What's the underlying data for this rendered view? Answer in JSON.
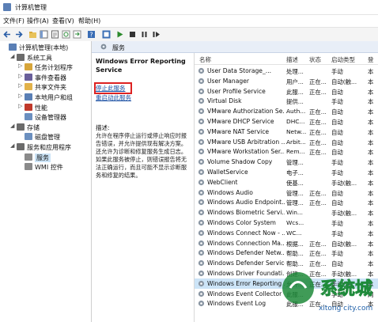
{
  "window": {
    "title": "计算机管理"
  },
  "menu": [
    "文件(F)",
    "操作(A)",
    "查看(V)",
    "帮助(H)"
  ],
  "tree": [
    {
      "label": "计算机管理(本地)",
      "indent": 0,
      "exp": "",
      "color": "#5a7fb5"
    },
    {
      "label": "系统工具",
      "indent": 1,
      "exp": "◢",
      "color": "#6b6b6b"
    },
    {
      "label": "任务计划程序",
      "indent": 2,
      "exp": "▷",
      "color": "#d7a53a"
    },
    {
      "label": "事件查看器",
      "indent": 2,
      "exp": "▷",
      "color": "#6a5f9a"
    },
    {
      "label": "共享文件夹",
      "indent": 2,
      "exp": "▷",
      "color": "#e2b24a"
    },
    {
      "label": "本地用户和组",
      "indent": 2,
      "exp": "▷",
      "color": "#5a7fb5"
    },
    {
      "label": "性能",
      "indent": 2,
      "exp": "▷",
      "color": "#c0392b"
    },
    {
      "label": "设备管理器",
      "indent": 2,
      "exp": "",
      "color": "#6b8fbf"
    },
    {
      "label": "存储",
      "indent": 1,
      "exp": "◢",
      "color": "#6b6b6b"
    },
    {
      "label": "磁盘管理",
      "indent": 2,
      "exp": "",
      "color": "#6b8fbf"
    },
    {
      "label": "服务和应用程序",
      "indent": 1,
      "exp": "◢",
      "color": "#6b6b6b"
    },
    {
      "label": "服务",
      "indent": 2,
      "exp": "",
      "color": "#8a8a8a",
      "selected": true
    },
    {
      "label": "WMI 控件",
      "indent": 2,
      "exp": "",
      "color": "#8a8a8a"
    }
  ],
  "header": {
    "title": "服务"
  },
  "detail": {
    "service_title": "Windows Error Reporting Service",
    "stop_link": "停止此服务",
    "restart_link": "重启动此服务",
    "desc_label": "描述:",
    "desc_text": "允许在程序停止运行或停止响应时报告错误，并允许提供现有解决方案。还允许为诊断和修复服务生成日志。如果此服务被停止，则错误报告将无法正确运行，而且可能不显示诊断服务和修复的结果。"
  },
  "columns": {
    "name": "名称",
    "desc": "描述",
    "status": "状态",
    "startup": "启动类型",
    "login": "登"
  },
  "services": [
    {
      "name": "User Data Storage_...",
      "desc": "处理...",
      "status": "",
      "startup": "手动",
      "login": "本"
    },
    {
      "name": "User Manager",
      "desc": "用户...",
      "status": "正在...",
      "startup": "自动(触...",
      "login": "本"
    },
    {
      "name": "User Profile Service",
      "desc": "此服...",
      "status": "正在...",
      "startup": "自动",
      "login": "本"
    },
    {
      "name": "Virtual Disk",
      "desc": "提供...",
      "status": "",
      "startup": "手动",
      "login": "本"
    },
    {
      "name": "VMware Authorization Se...",
      "desc": "Auth...",
      "status": "正在...",
      "startup": "自动",
      "login": "本"
    },
    {
      "name": "VMware DHCP Service",
      "desc": "DHC...",
      "status": "正在...",
      "startup": "自动",
      "login": "本"
    },
    {
      "name": "VMware NAT Service",
      "desc": "Netw...",
      "status": "正在...",
      "startup": "自动",
      "login": "本"
    },
    {
      "name": "VMware USB Arbitration ...",
      "desc": "Arbit...",
      "status": "正在...",
      "startup": "自动",
      "login": "本"
    },
    {
      "name": "VMware Workstation Ser...",
      "desc": "Rem...",
      "status": "正在...",
      "startup": "自动",
      "login": "本"
    },
    {
      "name": "Volume Shadow Copy",
      "desc": "管理...",
      "status": "",
      "startup": "手动",
      "login": "本"
    },
    {
      "name": "WalletService",
      "desc": "电子...",
      "status": "",
      "startup": "手动",
      "login": "本"
    },
    {
      "name": "WebClient",
      "desc": "使基...",
      "status": "",
      "startup": "手动(触...",
      "login": "本"
    },
    {
      "name": "Windows Audio",
      "desc": "管理...",
      "status": "正在...",
      "startup": "自动",
      "login": "本"
    },
    {
      "name": "Windows Audio Endpoint...",
      "desc": "管理...",
      "status": "正在...",
      "startup": "自动",
      "login": "本"
    },
    {
      "name": "Windows Biometric Servi...",
      "desc": "Win...",
      "status": "",
      "startup": "手动(触...",
      "login": "本"
    },
    {
      "name": "Windows Color System",
      "desc": "Wcs...",
      "status": "",
      "startup": "手动",
      "login": "本"
    },
    {
      "name": "Windows Connect Now - ...",
      "desc": "WC...",
      "status": "",
      "startup": "手动",
      "login": "本"
    },
    {
      "name": "Windows Connection Ma...",
      "desc": "根据...",
      "status": "正在...",
      "startup": "自动(触...",
      "login": "本"
    },
    {
      "name": "Windows Defender Netw...",
      "desc": "帮助...",
      "status": "正在...",
      "startup": "手动",
      "login": "本"
    },
    {
      "name": "Windows Defender Service",
      "desc": "帮助...",
      "status": "正在...",
      "startup": "自动",
      "login": "本"
    },
    {
      "name": "Windows Driver Foundati...",
      "desc": "创建...",
      "status": "正在...",
      "startup": "手动(触...",
      "login": "本"
    },
    {
      "name": "Windows Error Reporting ...",
      "desc": "允许...",
      "status": "正在...",
      "startup": "手动(触...",
      "login": "本",
      "selected": true
    },
    {
      "name": "Windows Event Collector",
      "desc": "此服...",
      "status": "",
      "startup": "手动",
      "login": "网"
    },
    {
      "name": "Windows Event Log",
      "desc": "此服...",
      "status": "正在...",
      "startup": "自动",
      "login": "本"
    }
  ],
  "watermark": {
    "brand": "系统城",
    "url": "xitong city.com"
  }
}
